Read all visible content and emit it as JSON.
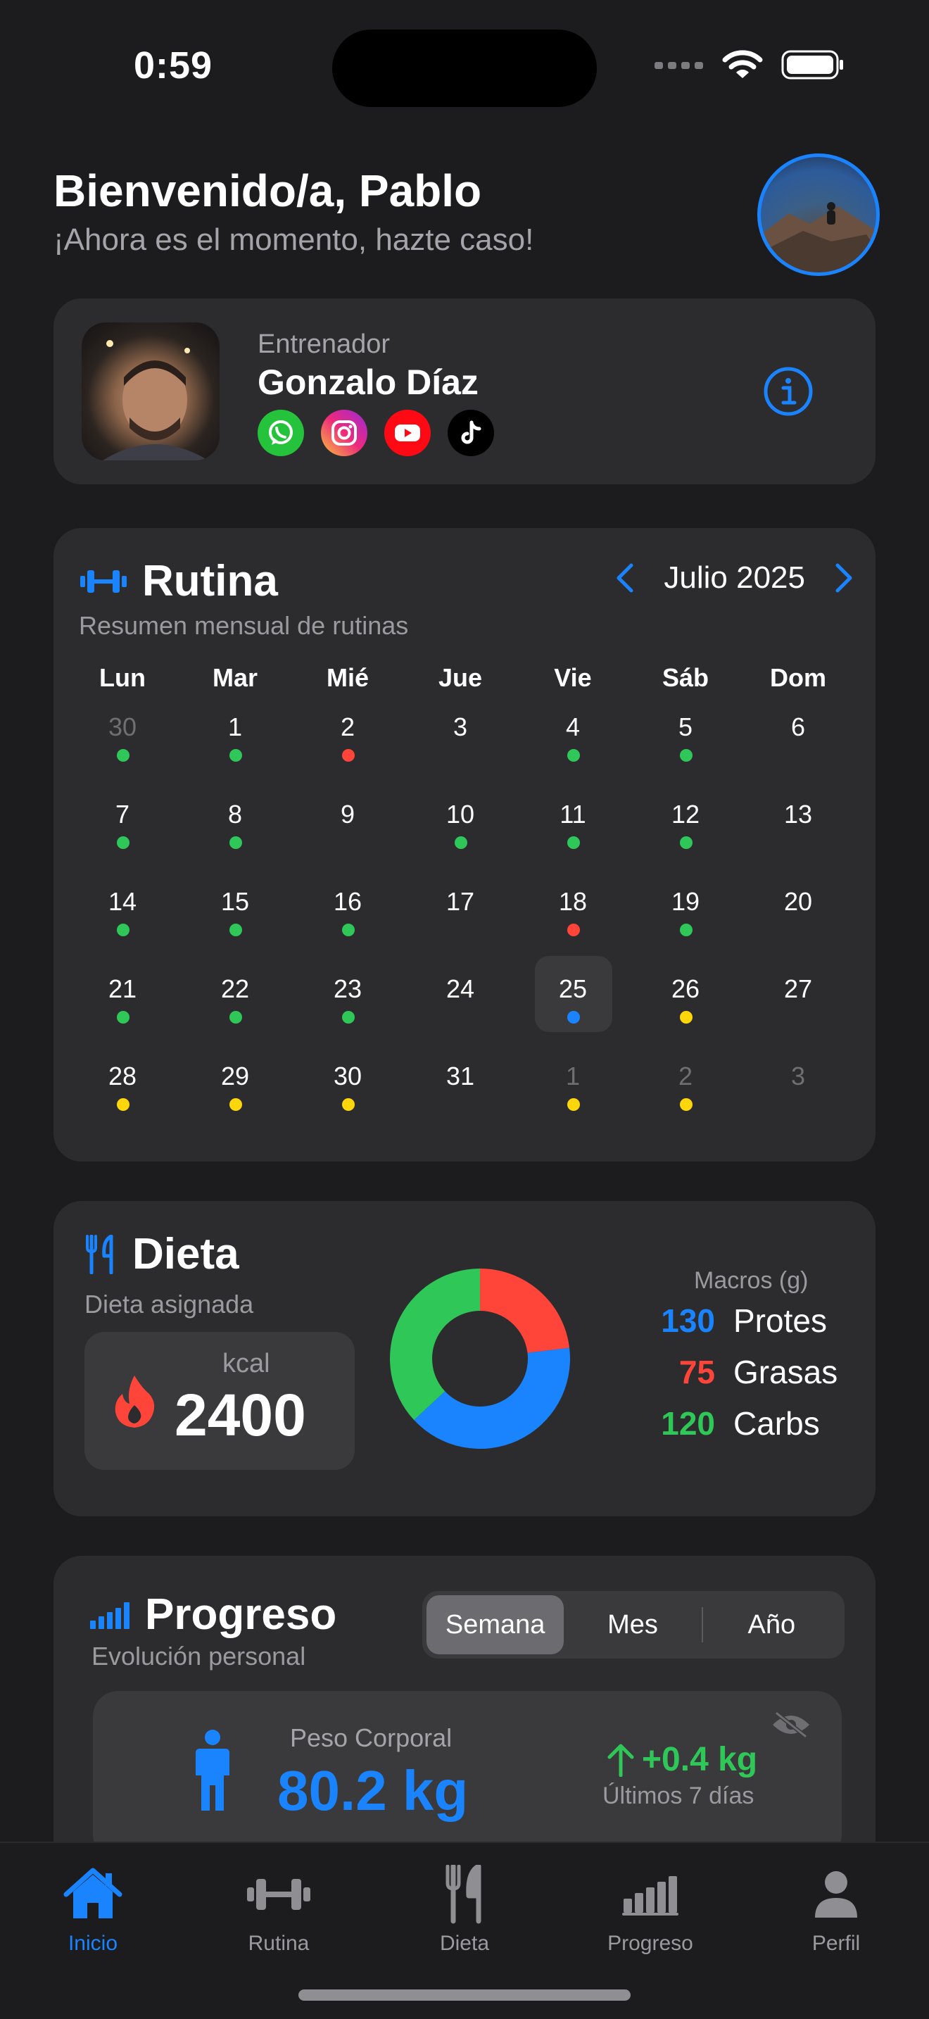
{
  "status_bar": {
    "time": "0:59"
  },
  "header": {
    "greeting": "Bienvenido/a, Pablo",
    "subtitle": "¡Ahora es el momento, hazte caso!"
  },
  "coach": {
    "role": "Entrenador",
    "name": "Gonzalo Díaz",
    "socials": [
      "whatsapp-icon",
      "instagram-icon",
      "youtube-icon",
      "tiktok-icon"
    ]
  },
  "routine": {
    "title": "Rutina",
    "subtitle": "Resumen mensual de rutinas",
    "month": "Julio 2025",
    "weekdays": [
      "Lun",
      "Mar",
      "Mié",
      "Jue",
      "Vie",
      "Sáb",
      "Dom"
    ],
    "days": [
      {
        "n": "30",
        "dim": true,
        "dot": "green"
      },
      {
        "n": "1",
        "dot": "green"
      },
      {
        "n": "2",
        "dot": "red"
      },
      {
        "n": "3"
      },
      {
        "n": "4",
        "dot": "green"
      },
      {
        "n": "5",
        "dot": "green"
      },
      {
        "n": "6"
      },
      {
        "n": "7",
        "dot": "green"
      },
      {
        "n": "8",
        "dot": "green"
      },
      {
        "n": "9"
      },
      {
        "n": "10",
        "dot": "green"
      },
      {
        "n": "11",
        "dot": "green"
      },
      {
        "n": "12",
        "dot": "green"
      },
      {
        "n": "13"
      },
      {
        "n": "14",
        "dot": "green"
      },
      {
        "n": "15",
        "dot": "green"
      },
      {
        "n": "16",
        "dot": "green"
      },
      {
        "n": "17"
      },
      {
        "n": "18",
        "dot": "red"
      },
      {
        "n": "19",
        "dot": "green"
      },
      {
        "n": "20"
      },
      {
        "n": "21",
        "dot": "green"
      },
      {
        "n": "22",
        "dot": "green"
      },
      {
        "n": "23",
        "dot": "green"
      },
      {
        "n": "24"
      },
      {
        "n": "25",
        "dot": "blue",
        "today": true
      },
      {
        "n": "26",
        "dot": "yellow"
      },
      {
        "n": "27"
      },
      {
        "n": "28",
        "dot": "yellow"
      },
      {
        "n": "29",
        "dot": "yellow"
      },
      {
        "n": "30",
        "dot": "yellow"
      },
      {
        "n": "31"
      },
      {
        "n": "1",
        "dim": true,
        "dot": "yellow"
      },
      {
        "n": "2",
        "dim": true,
        "dot": "yellow"
      },
      {
        "n": "3",
        "dim": true
      }
    ]
  },
  "diet": {
    "title": "Dieta",
    "subtitle": "Dieta asignada",
    "kcal_label": "kcal",
    "kcal_value": "2400",
    "macros_title": "Macros (g)",
    "macros": [
      {
        "value": "130",
        "name": "Protes",
        "color": "#1a84ff"
      },
      {
        "value": "75",
        "name": "Grasas",
        "color": "#ff453a"
      },
      {
        "value": "120",
        "name": "Carbs",
        "color": "#30c759"
      }
    ]
  },
  "progress": {
    "title": "Progreso",
    "subtitle": "Evolución personal",
    "segments": [
      "Semana",
      "Mes",
      "Año"
    ],
    "active_segment": "Semana",
    "weight_label": "Peso Corporal",
    "weight_value": "80.2 kg",
    "weight_change": "+0.4 kg",
    "weight_period": "Últimos 7 días"
  },
  "tabs": [
    {
      "label": "Inicio",
      "icon": "house-icon",
      "active": true
    },
    {
      "label": "Rutina",
      "icon": "dumbbell-icon"
    },
    {
      "label": "Dieta",
      "icon": "fork-knife-icon"
    },
    {
      "label": "Progreso",
      "icon": "chart-bars-icon"
    },
    {
      "label": "Perfil",
      "icon": "person-icon"
    }
  ],
  "colors": {
    "accent": "#1a84ff",
    "green": "#30c759",
    "red": "#ff453a",
    "yellow": "#ffd60a",
    "card": "#2c2c2e",
    "background": "#1c1c1e"
  }
}
